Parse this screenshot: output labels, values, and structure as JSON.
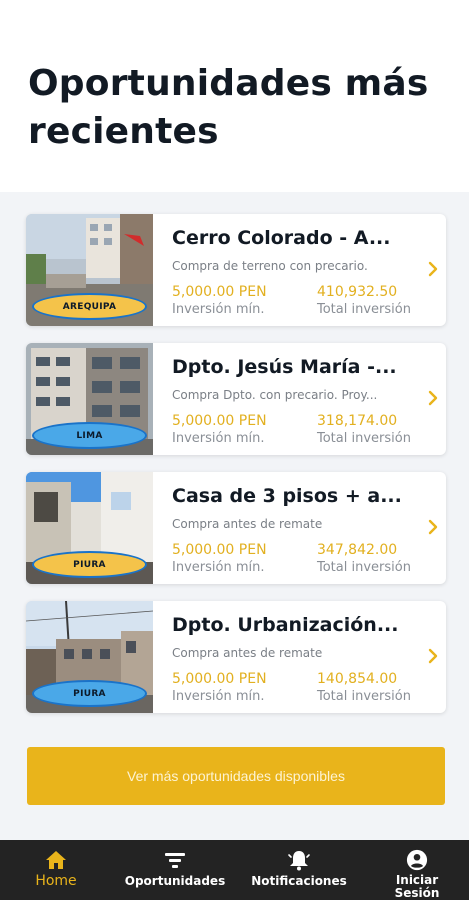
{
  "page": {
    "title": "Oportunidades más recientes"
  },
  "opportunities": [
    {
      "title": "Cerro Colorado - A...",
      "description": "Compra de terreno con precario.",
      "min_investment": "5,000.00 PEN",
      "min_investment_label": "Inversión mín.",
      "total_investment": "410,932.50",
      "total_investment_label": "Total inversión",
      "city": "AREQUIPA",
      "badge_color": "yellow"
    },
    {
      "title": "Dpto. Jesús María -...",
      "description": "Compra Dpto. con precario. Proy...",
      "min_investment": "5,000.00 PEN",
      "min_investment_label": "Inversión mín.",
      "total_investment": "318,174.00",
      "total_investment_label": "Total inversión",
      "city": "LIMA",
      "badge_color": "blue"
    },
    {
      "title": "Casa de 3 pisos + a...",
      "description": "Compra antes de remate",
      "min_investment": "5,000.00 PEN",
      "min_investment_label": "Inversión mín.",
      "total_investment": "347,842.00",
      "total_investment_label": "Total inversión",
      "city": "PIURA",
      "badge_color": "yellow"
    },
    {
      "title": "Dpto. Urbanización...",
      "description": "Compra antes de remate",
      "min_investment": "5,000.00 PEN",
      "min_investment_label": "Inversión mín.",
      "total_investment": "140,854.00",
      "total_investment_label": "Total inversión",
      "city": "PIURA",
      "badge_color": "blue"
    }
  ],
  "cta": {
    "label": "Ver más oportunidades disponibles"
  },
  "bottom_nav": [
    {
      "label": "Home",
      "icon": "home-icon",
      "active": true
    },
    {
      "label": "Oportunidades",
      "icon": "filter-icon",
      "active": false
    },
    {
      "label": "Notificaciones",
      "icon": "bell-icon",
      "active": false
    },
    {
      "label": "Iniciar Sesión",
      "icon": "user-icon",
      "active": false
    }
  ],
  "colors": {
    "accent": "#e9b41b",
    "title": "#121a24",
    "nav_bg": "#232323",
    "badge_border": "#1a73c9"
  }
}
